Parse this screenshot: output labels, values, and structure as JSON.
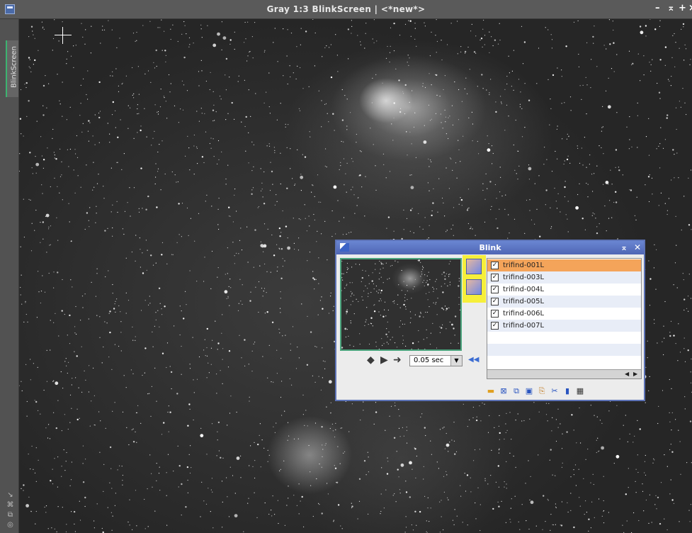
{
  "window": {
    "title": "Gray 1:3 BlinkScreen | <*new*>",
    "controls": [
      "–",
      "⌅",
      "+",
      "×"
    ]
  },
  "side_tab": {
    "label": "BlinkScreen"
  },
  "side_tools": [
    "↘",
    "⌘",
    "⧉",
    "◎"
  ],
  "dialog": {
    "title": "Blink",
    "controls": [
      "⌅",
      "✕"
    ],
    "playback": {
      "prev": "◆",
      "play": "▶",
      "next": "➜",
      "interval": "0.05 sec",
      "rewind": "◀◀"
    },
    "files": [
      {
        "name": "trifind-001L",
        "checked": true,
        "selected": true
      },
      {
        "name": "trifind-003L",
        "checked": true,
        "selected": false
      },
      {
        "name": "trifind-004L",
        "checked": true,
        "selected": false
      },
      {
        "name": "trifind-005L",
        "checked": true,
        "selected": false
      },
      {
        "name": "trifind-006L",
        "checked": true,
        "selected": false
      },
      {
        "name": "trifind-007L",
        "checked": true,
        "selected": false
      }
    ],
    "toolbar": [
      "open-folder-icon",
      "close-icon",
      "close-all-icon",
      "save-icon",
      "copy-icon",
      "crop-icon",
      "statistics-icon",
      "movie-icon"
    ]
  }
}
